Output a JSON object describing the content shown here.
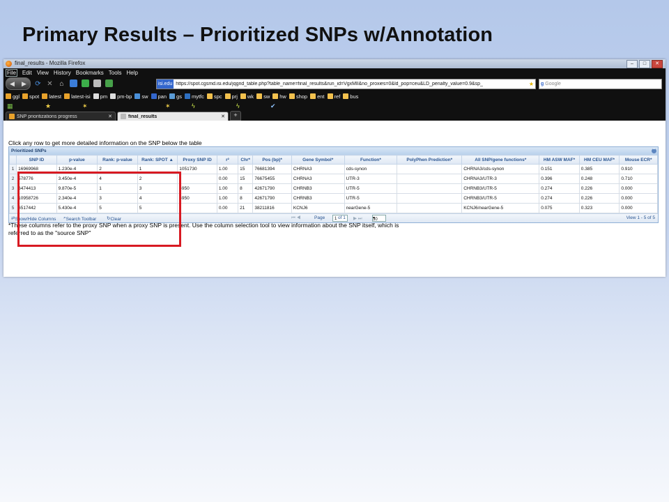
{
  "slide": {
    "title": "Primary Results – Prioritized SNPs w/Annotation"
  },
  "browser": {
    "window_title": "final_results - Mozilla Firefox",
    "window_controls": [
      "–",
      "□",
      "✕"
    ],
    "menu": [
      "File",
      "Edit",
      "View",
      "History",
      "Bookmarks",
      "Tools",
      "Help"
    ],
    "address": {
      "site": "isi.edu",
      "url": "https://spot.cgsmd.isi.edu/jqgrid_table.php?table_name=final_results&run_id=VgxMlI&no_proxies=0&ld_pop=ceu&LD_penalty_value=0.9&sp_"
    },
    "search_placeholder": "Google",
    "bookmarks": [
      "ggl",
      "spot",
      "latest",
      "latest-isi",
      "pm",
      "pm-bp",
      "sw",
      "pan",
      "gs",
      "mytfc",
      "spc",
      "prj",
      "wk",
      "sw",
      "hw",
      "shop",
      "ent",
      "ref",
      "bus"
    ],
    "tabs": [
      {
        "label": "SNP prioritizations progress",
        "active": false
      },
      {
        "label": "final_results",
        "active": true
      }
    ],
    "new_tab": "+"
  },
  "page": {
    "instruction": "Click any row to get more detailed information on the SNP below the table",
    "grid_caption": "Prioritized SNPs",
    "columns": [
      "",
      "SNP ID",
      "p-value",
      "Rank: p-value",
      "Rank: SPOT ▲",
      "Proxy SNP ID",
      "r²",
      "Chr*",
      "Pos (bp)*",
      "Gene Symbol*",
      "Function*",
      "PolyPhen Prediction*",
      "All SNP/gene functions*",
      "HM ASW MAF*",
      "HM CEU MAF*",
      "Mouse ECR*"
    ],
    "rows": [
      [
        "1",
        "16969968",
        "1.230e-4",
        "2",
        "1",
        "1051730",
        "1.00",
        "15",
        "76681394",
        "CHRNA3",
        "cds-synon",
        "",
        "CHRNA3/cds-synon",
        "0.151",
        "0.385",
        "0.910"
      ],
      [
        "2",
        "578776",
        "3.450e-4",
        "4",
        "2",
        "",
        "0.00",
        "15",
        "76675455",
        "CHRNA3",
        "UTR-3",
        "",
        "CHRNA3/UTR-3",
        "0.396",
        "0.248",
        "0.710"
      ],
      [
        "3",
        "6474413",
        "9.870e-5",
        "1",
        "3",
        "4950",
        "1.00",
        "8",
        "42671790",
        "CHRNB3",
        "UTR-5",
        "",
        "CHRNB3/UTR-5",
        "0.274",
        "0.226",
        "0.000"
      ],
      [
        "4",
        "10958726",
        "2.340e-4",
        "3",
        "4",
        "4950",
        "1.00",
        "8",
        "42671790",
        "CHRNB3",
        "UTR-5",
        "",
        "CHRNB3/UTR-5",
        "0.274",
        "0.226",
        "0.000"
      ],
      [
        "5",
        "6517442",
        "5.430e-4",
        "5",
        "5",
        "",
        "0.00",
        "21",
        "38211816",
        "KCNJ6",
        "nearGene-5",
        "",
        "KCNJ6/nearGene-5",
        "0.075",
        "0.323",
        "0.000"
      ]
    ],
    "pager": {
      "show_hide": "Show/Hide Columns",
      "search_toolbar": "Search Toolbar",
      "clear": "Clear",
      "page_label": "Page",
      "page_value": "1",
      "of_label": "of 1",
      "per_page": "30",
      "view_range": "View 1 - 5 of 5"
    },
    "footnote": "*These columns refer to the proxy SNP when a proxy SNP is present. Use the column selection tool to view information about the SNP itself, which is referred to as the \"source SNP\""
  },
  "colors": {
    "highlight_box": "#d81a22",
    "grid_header": "#2a5591",
    "chrome": "#101010"
  }
}
